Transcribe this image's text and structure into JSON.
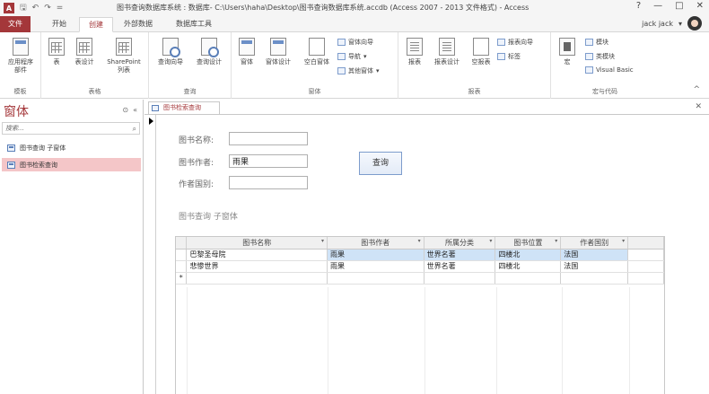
{
  "window": {
    "app_icon_letter": "A",
    "title": "图书查询数据库系统 : 数据库- C:\\Users\\haha\\Desktop\\图书查询数据库系统.accdb (Access 2007 - 2013 文件格式) - Access",
    "help": "?",
    "minimize": "—",
    "restore": "□",
    "close": "✕"
  },
  "qat": {
    "save": "🖫",
    "undo": "↶",
    "redo": "↷",
    "customize": "="
  },
  "tabs": [
    {
      "label": "文件"
    },
    {
      "label": "开始"
    },
    {
      "label": "创建"
    },
    {
      "label": "外部数据"
    },
    {
      "label": "数据库工具"
    }
  ],
  "user": {
    "name": "jack jack",
    "dropdown": "▾"
  },
  "ribbon": {
    "groups": {
      "template": "模板",
      "tables": "表格",
      "queries": "查询",
      "forms": "窗体",
      "reports": "报表",
      "macros": "宏与代码"
    },
    "buttons": {
      "app_parts": "应用程序\n部件",
      "table": "表",
      "table_design": "表设计",
      "sharepoint": "SharePoint\n列表",
      "query_wizard": "查询向导",
      "query_design": "查询设计",
      "form": "窗体",
      "form_design": "窗体设计",
      "blank_form": "空白窗体",
      "form_wizard": "窗体向导",
      "navigation": "导航",
      "more_forms": "其他窗体",
      "report": "报表",
      "report_design": "报表设计",
      "blank_report": "空报表",
      "report_wizard": "报表向导",
      "labels": "标签",
      "macro": "宏",
      "module": "模块",
      "class_module": "类模块",
      "visual_basic": "Visual Basic"
    },
    "collapse": "^"
  },
  "navpane": {
    "title": "窗体",
    "search_placeholder": "搜索...",
    "search_icon": "⌕",
    "menu_btn": "⊙",
    "collapse_btn": "«",
    "items": [
      {
        "label": "图书查询 子窗体"
      },
      {
        "label": "图书检索查询"
      }
    ]
  },
  "document": {
    "tab_label": "图书检索查询",
    "close": "✕",
    "fields": {
      "book_name_label": "图书名称:",
      "book_name_value": "",
      "author_label": "图书作者:",
      "author_value": "雨果",
      "nationality_label": "作者国别:",
      "nationality_value": ""
    },
    "query_button": "查询",
    "subform_caption": "图书查询 子窗体",
    "table": {
      "columns": [
        "图书名称",
        "图书作者",
        "所属分类",
        "图书位置",
        "作者国别"
      ],
      "dropdown": "▾",
      "rows": [
        [
          "巴黎圣母院",
          "雨果",
          "世界名著",
          "四楼北",
          "法国"
        ],
        [
          "悲惨世界",
          "雨果",
          "世界名著",
          "四楼北",
          "法国"
        ]
      ],
      "new_row_marker": "*"
    }
  }
}
